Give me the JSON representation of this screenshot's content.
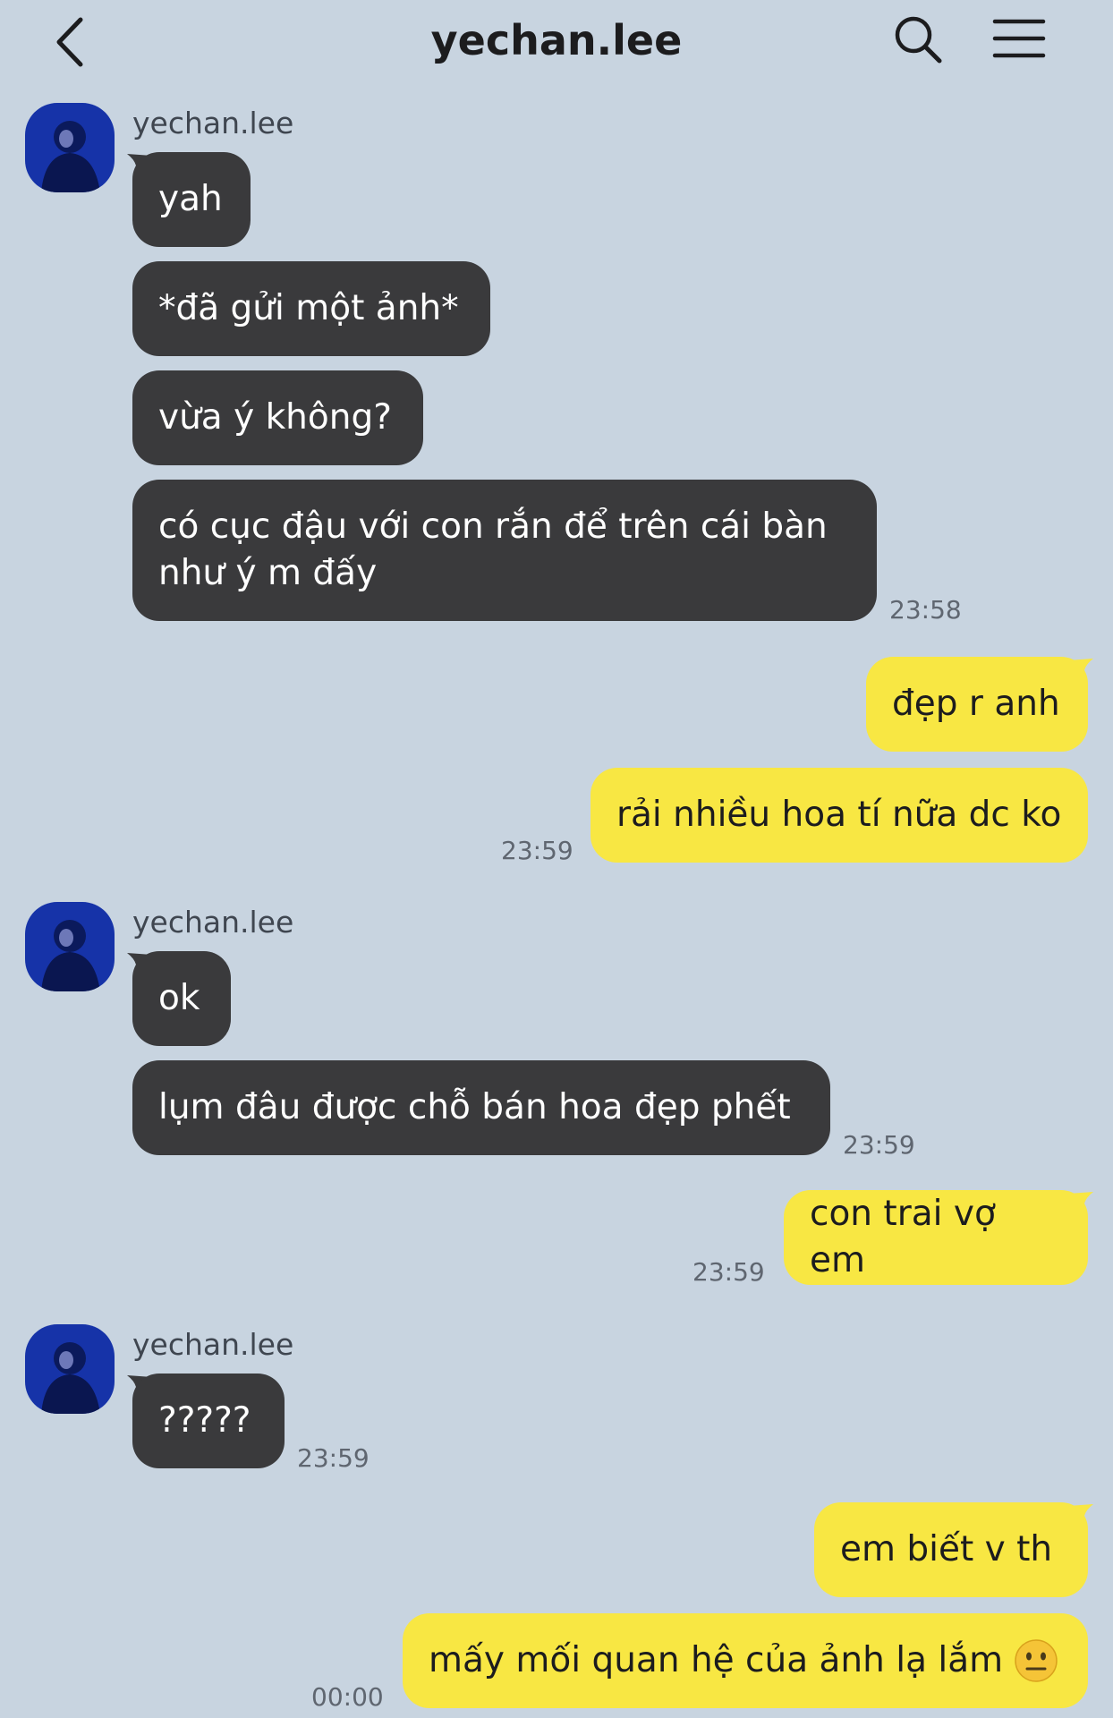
{
  "header": {
    "title": "yechan.lee",
    "back_icon": "chevron-left-icon",
    "search_icon": "search-icon",
    "menu_icon": "menu-icon"
  },
  "colors": {
    "background": "#c8d4e0",
    "incoming_bubble": "#3a3a3c",
    "outgoing_bubble": "#f8e743"
  },
  "messages": {
    "g1": {
      "sender": "yechan.lee",
      "m1": "yah",
      "m2": "*đã gửi một ảnh*",
      "m3": "vừa ý không?",
      "m4_line1": "có cục đậu với con rắn để trên cái bàn",
      "m4_line2": "như ý m đấy",
      "time": "23:58"
    },
    "o1": {
      "m1": "đẹp r anh",
      "m2": "rải nhiều hoa tí nữa dc ko",
      "time": "23:59"
    },
    "g2": {
      "sender": "yechan.lee",
      "m1": "ok",
      "m2": "lụm đâu được chỗ bán hoa đẹp phết",
      "time": "23:59"
    },
    "o2": {
      "m1": "con trai vợ em",
      "time": "23:59"
    },
    "g3": {
      "sender": "yechan.lee",
      "m1": "?????",
      "time": "23:59"
    },
    "o3": {
      "m1": "em biết v th",
      "m2": "mấy mối quan hệ của ảnh lạ lắm",
      "m2_emoji": "neutral-face-emoji",
      "time": "00:00"
    }
  }
}
